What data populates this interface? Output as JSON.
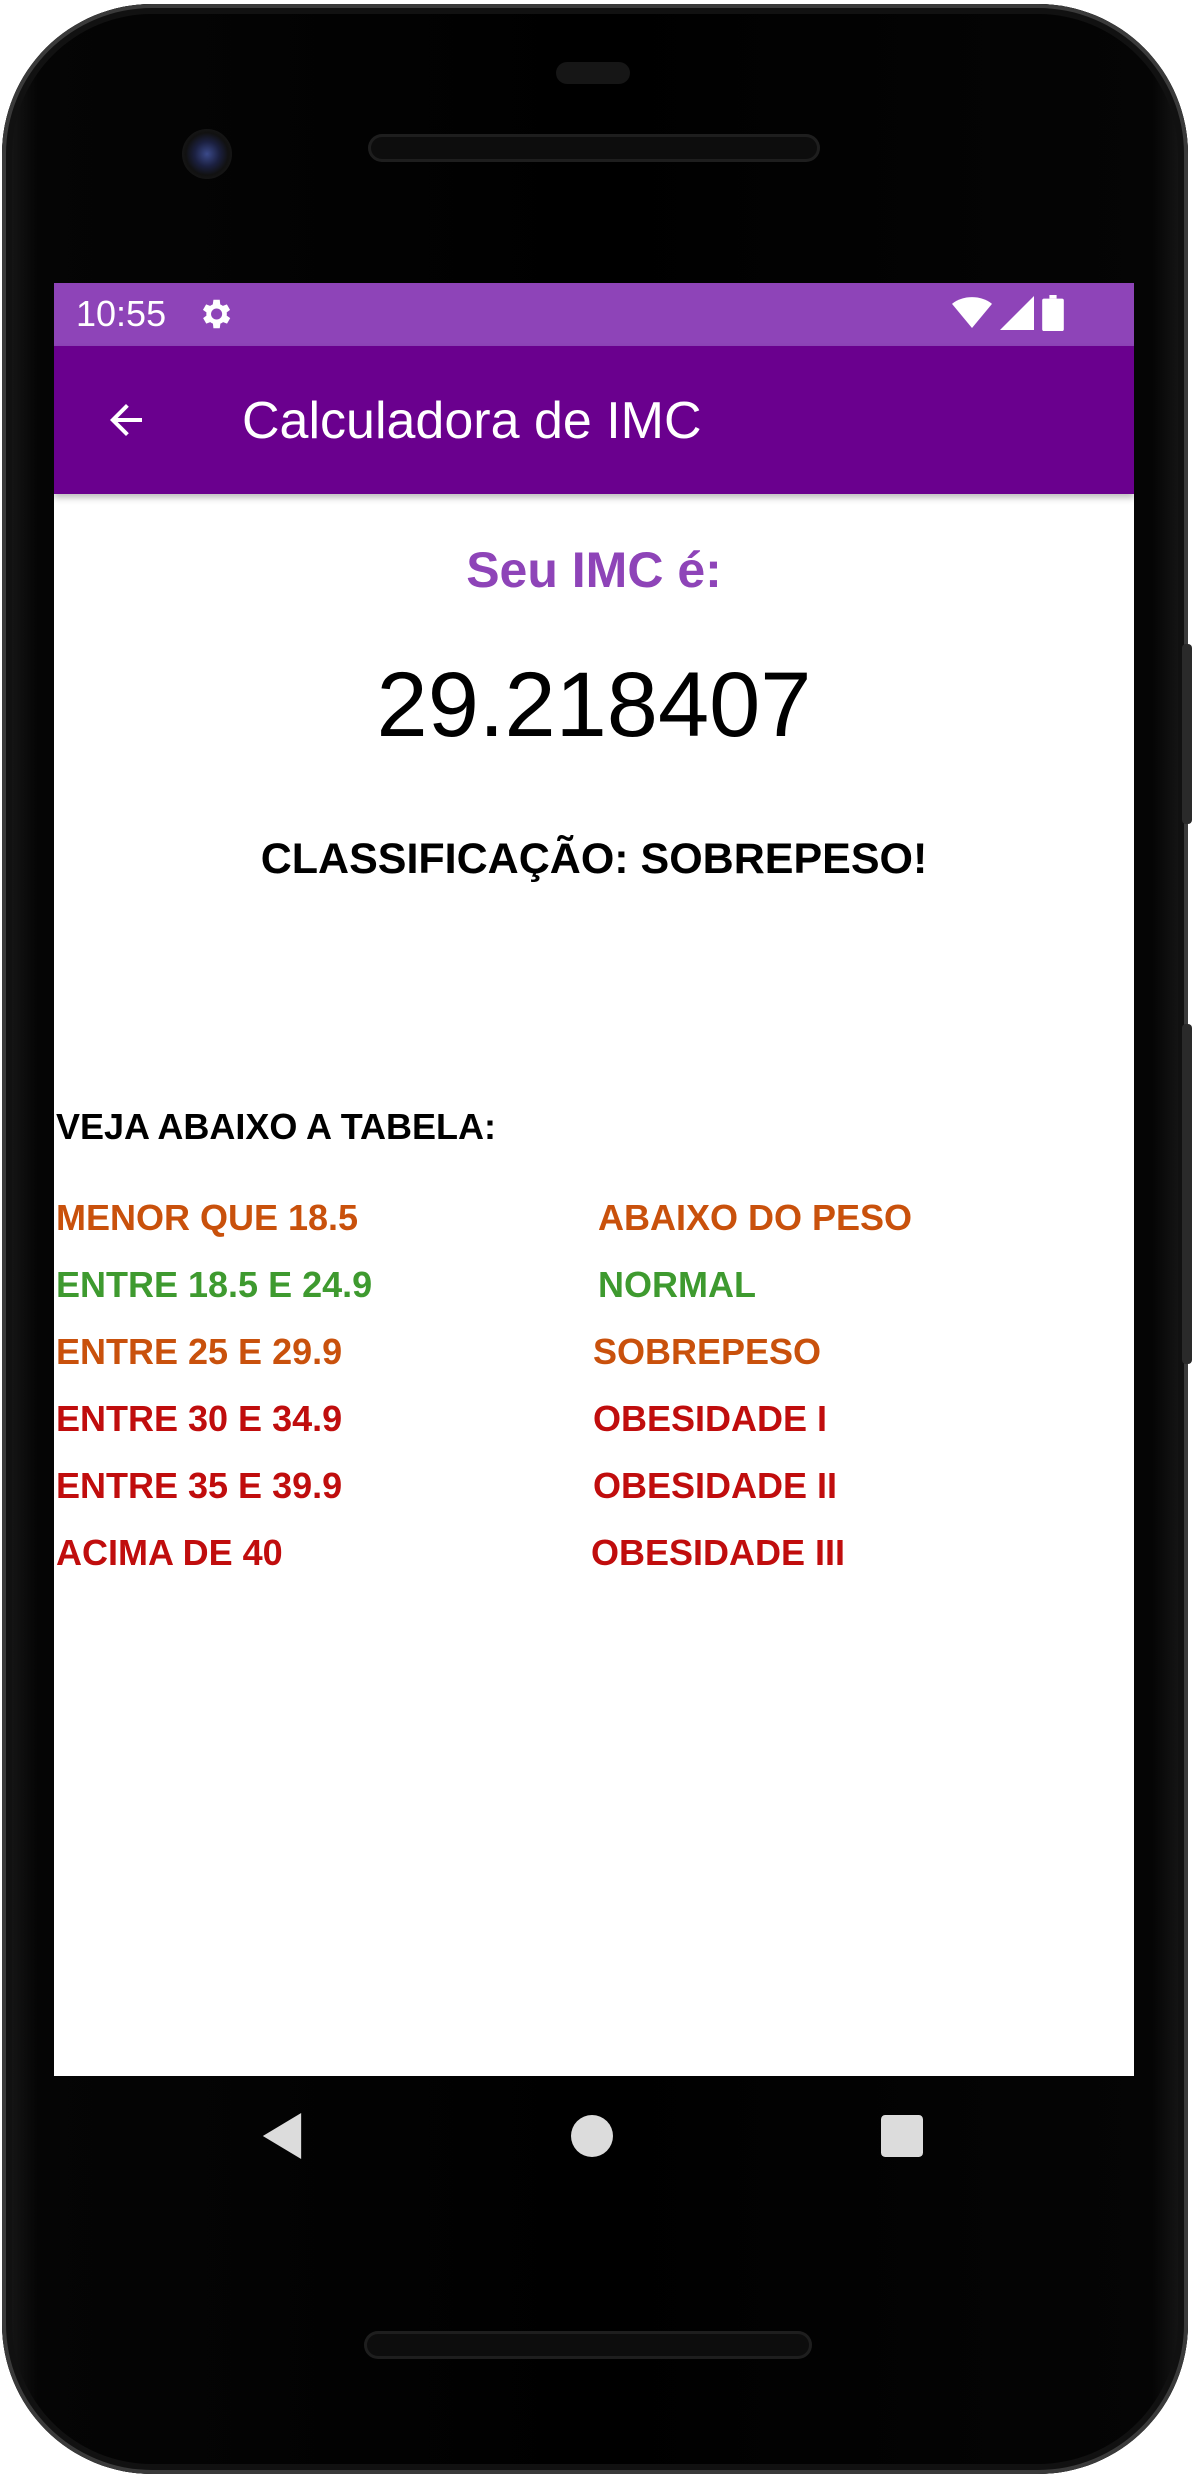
{
  "status_bar": {
    "time": "10:55",
    "icons": [
      "gear-icon",
      "wifi-icon",
      "signal-icon",
      "battery-icon"
    ],
    "color": "#8e44b8"
  },
  "app_bar": {
    "title": "Calculadora de IMC",
    "back_icon": "arrow-back-icon",
    "color": "#6a008e"
  },
  "result": {
    "label": "Seu IMC é:",
    "value": "29.218407",
    "classification": "CLASSIFICAÇÃO: SOBREPESO!",
    "label_color": "#8e44b8"
  },
  "table": {
    "title": "VEJA ABAIXO A TABELA:",
    "rows": [
      {
        "range": "MENOR QUE 18.5",
        "category": "ABAIXO DO PESO",
        "color": "#c9510c"
      },
      {
        "range": "ENTRE 18.5 E 24.9",
        "category": "NORMAL",
        "color": "#3e9a2f"
      },
      {
        "range": "ENTRE 25 E 29.9",
        "category": "SOBREPESO",
        "color": "#c9510c"
      },
      {
        "range": "ENTRE 30 E 34.9",
        "category": "OBESIDADE I",
        "color": "#c00d0d"
      },
      {
        "range": "ENTRE 35 E 39.9",
        "category": "OBESIDADE II",
        "color": "#c00d0d"
      },
      {
        "range": "ACIMA DE 40",
        "category": "OBESIDADE III",
        "color": "#c00d0d"
      }
    ]
  },
  "nav_bar": {
    "buttons": [
      "back-triangle-icon",
      "home-circle-icon",
      "recents-square-icon"
    ]
  }
}
